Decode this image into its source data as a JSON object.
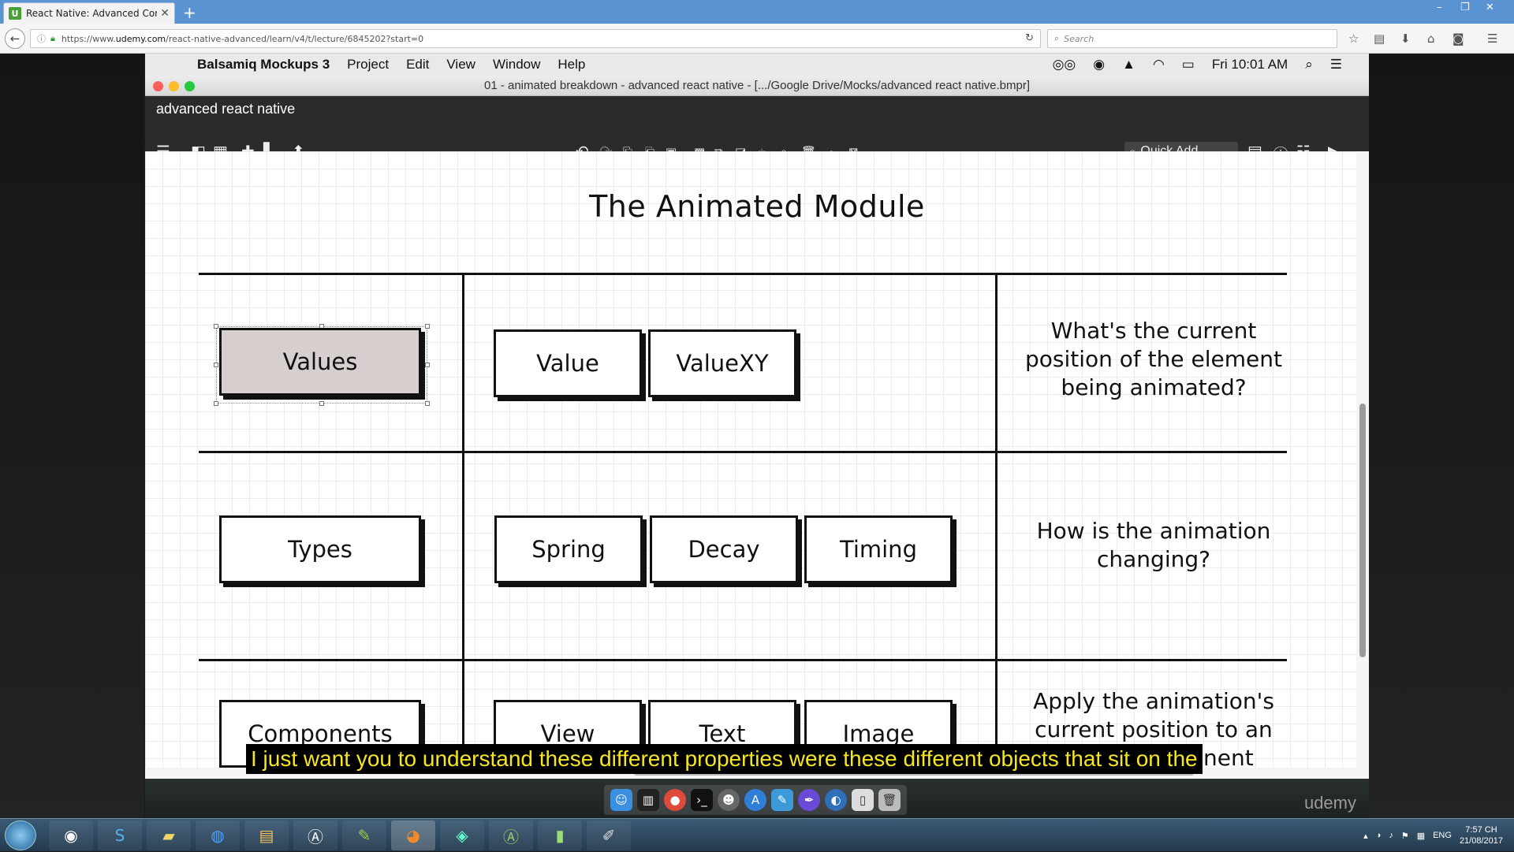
{
  "browser": {
    "tab_title": "React Native: Advanced Cor",
    "tab_favicon": "U",
    "url_prefix": "https://www.",
    "url_host": "udemy.com",
    "url_path": "/react-native-advanced/learn/v4/t/lecture/6845202?start=0",
    "search_placeholder": "Search"
  },
  "mac_menubar": {
    "app_name": "Balsamiq Mockups 3",
    "menus": [
      "Project",
      "Edit",
      "View",
      "Window",
      "Help"
    ],
    "clock": "Fri 10:01 AM"
  },
  "window": {
    "title": "01 - animated breakdown - advanced react native - [.../Google Drive/Mocks/advanced react native.bmpr]",
    "doc_name": "advanced react native",
    "quick_add_label": "Quick Add"
  },
  "mockup": {
    "title": "The Animated Module",
    "rows": [
      {
        "category": "Values",
        "items": [
          "Value",
          "ValueXY"
        ],
        "description": "What's the current position of the element being animated?"
      },
      {
        "category": "Types",
        "items": [
          "Spring",
          "Decay",
          "Timing"
        ],
        "description": "How is the animation changing?"
      },
      {
        "category": "Components",
        "items": [
          "View",
          "Text",
          "Image"
        ],
        "description": "Apply the animation's current position to an actual component"
      }
    ]
  },
  "caption": "I just want you to understand these different properties were these different objects that sit on the",
  "watermark": "udemy",
  "taskbar": {
    "language": "ENG",
    "time": "7:57 CH",
    "date": "21/08/2017"
  },
  "colors": {
    "browser_tabbar": "#5a93d2",
    "app_toolbar": "#2b2b2b",
    "selected_button": "#d7cece",
    "caption_text": "#f6e61f"
  }
}
